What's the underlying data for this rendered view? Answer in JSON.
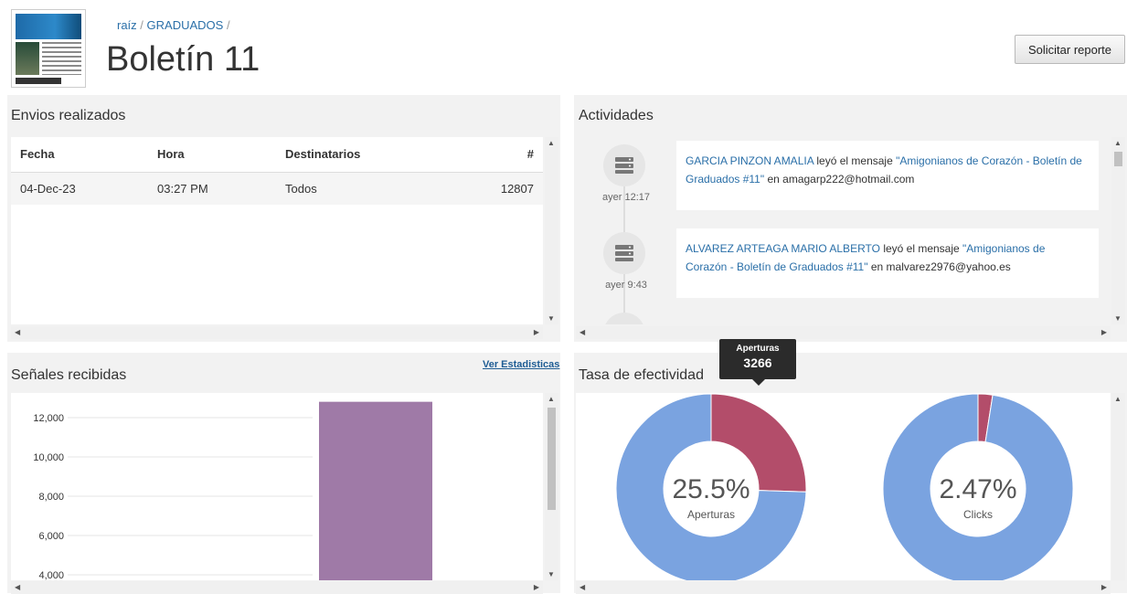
{
  "header": {
    "breadcrumb_root": "raíz",
    "breadcrumb_sep1": "/",
    "breadcrumb_folder": "GRADUADOS",
    "breadcrumb_sep2": "/",
    "title": "Boletín 11",
    "report_button": "Solicitar reporte"
  },
  "envios": {
    "title": "Envios realizados",
    "columns": [
      "Fecha",
      "Hora",
      "Destinatarios",
      "#"
    ],
    "rows": [
      {
        "fecha": "04-Dec-23",
        "hora": "03:27 PM",
        "destinatarios": "Todos",
        "count": "12807"
      }
    ]
  },
  "actividades": {
    "title": "Actividades",
    "items": [
      {
        "name": "GARCIA PINZON AMALIA",
        "action": "leyó el mensaje",
        "message": "\"Amigonianos de Corazón - Boletín de Graduados #11\"",
        "prep": "en",
        "email": "amagarp222@hotmail.com",
        "time": "ayer 12:17"
      },
      {
        "name": "ALVAREZ ARTEAGA MARIO ALBERTO",
        "action": "leyó el mensaje",
        "message": "\"Amigonianos de Corazón - Boletín de Graduados #11\"",
        "prep": "en",
        "email": "malvarez2976@yahoo.es",
        "time": "ayer 9:43"
      }
    ]
  },
  "senales": {
    "title": "Señales recibidas",
    "link": "Ver Estadisticas"
  },
  "tasa": {
    "title": "Tasa de efectividad",
    "tooltip_label": "Aperturas",
    "tooltip_value": "3266",
    "donut1_value": "25.5%",
    "donut1_label": "Aperturas",
    "donut2_value": "2.47%",
    "donut2_label": "Clicks",
    "colors": {
      "main": "#7aa3e0",
      "accent": "#b34d6a"
    }
  },
  "chart_data": [
    {
      "type": "bar",
      "title": "Señales recibidas",
      "yticks": [
        "12,000",
        "10,000",
        "8,000",
        "6,000",
        "4,000"
      ],
      "ylim": [
        4000,
        12807
      ],
      "series": [
        {
          "values": [
            12807
          ]
        }
      ],
      "color": "#9f7aa7"
    },
    {
      "type": "pie",
      "title": "Aperturas",
      "slices": [
        {
          "label": "Aperturas",
          "value": 25.5
        },
        {
          "label": "",
          "value": 74.5
        }
      ]
    },
    {
      "type": "pie",
      "title": "Clicks",
      "slices": [
        {
          "label": "Clicks",
          "value": 2.47
        },
        {
          "label": "",
          "value": 97.53
        }
      ]
    }
  ]
}
